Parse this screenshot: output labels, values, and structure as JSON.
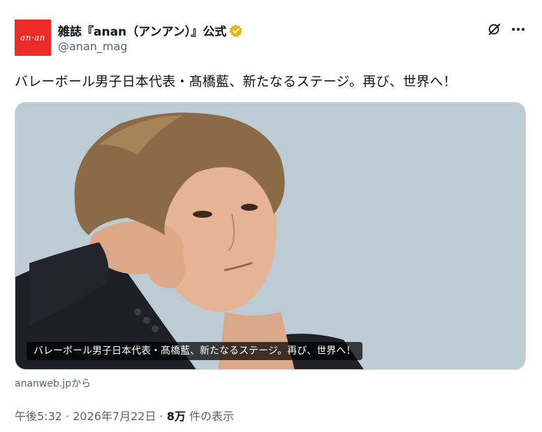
{
  "account": {
    "avatar_text": "an·an",
    "display_name": "雑誌『anan（アンアン）』公式",
    "handle": "@anan_mag",
    "verified": true,
    "verified_color": "#e2b719"
  },
  "icons": {
    "grok": "grok-icon",
    "more": "more-icon",
    "verified": "verified-badge-icon"
  },
  "tweet": {
    "text": "バレーボール男子日本代表・髙橋藍、新たなるステージ。再び、世界へ！"
  },
  "media": {
    "caption": "バレーボール男子日本代表・髙橋藍、新たなるステージ。再び、世界へ！",
    "description_icon": "portrait-photo"
  },
  "card": {
    "source": "ananweb.jpから"
  },
  "meta": {
    "time": "午後5:32",
    "separator": " · ",
    "date": "2026年7月22日",
    "views_count": "8万",
    "views_label": " 件の表示"
  },
  "colors": {
    "brand": "#ec2b27",
    "text_primary": "#0f1419",
    "text_secondary": "#536471",
    "photo_background": "#bccbd4"
  }
}
